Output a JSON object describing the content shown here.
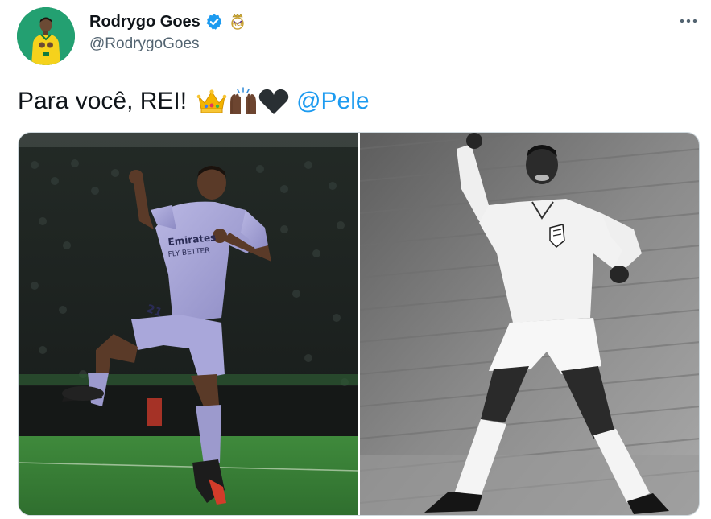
{
  "tweet": {
    "author": {
      "display_name": "Rodrygo Goes",
      "handle": "@RodrygoGoes",
      "verified_icon": "verified-badge-icon",
      "affiliate_badge_icon": "real-madrid-crest-icon",
      "avatar_icon": "profile-avatar"
    },
    "more_icon": "more-horizontal-icon",
    "text": "Para você, REI!",
    "emojis": [
      "crown-emoji",
      "raising-hands-dark-skin-emoji",
      "black-heart-emoji"
    ],
    "mention": "@Pele",
    "media": [
      {
        "name": "photo-rodrygo-celebrating",
        "shirt_text": "Emirates FLY BETTER",
        "number": "21"
      },
      {
        "name": "photo-pele-celebrating-black-and-white"
      }
    ]
  },
  "colors": {
    "link": "#1d9bf0",
    "secondary_text": "#536471",
    "primary_text": "#0f1419",
    "border": "#cfd9de",
    "verified": "#1d9bf0"
  }
}
